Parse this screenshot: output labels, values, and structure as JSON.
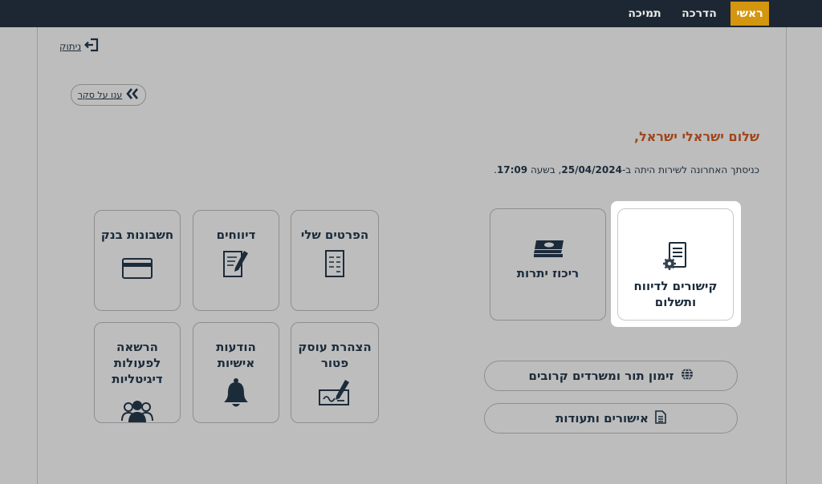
{
  "nav": {
    "home": "ראשי",
    "guide": "הדרכה",
    "support": "תמיכה"
  },
  "logout_label": "ניתוק",
  "survey_label": "ענו על סקר",
  "greeting": "שלום ישראלי ישראל,",
  "last_login": {
    "prefix": "כניסתך האחרונה לשירות היתה ב-",
    "date": "25/04/2024",
    "middle": ", בשעה ",
    "time": "17:09",
    "suffix": "."
  },
  "tiles": {
    "payment_links": "קישורים לדיווח\nותשלום",
    "balance_summary": "ריכוז יתרות",
    "my_details": "הפרטים שלי",
    "reports": "דיווחים",
    "bank_accounts": "חשבונות בנק",
    "exempt_declaration": "הצהרת עוסק\nפטור",
    "personal_messages": "הודעות\nאישיות",
    "digital_authorization": "הרשאה\nלפעולות\nדיגיטליות"
  },
  "links": {
    "appointments": "זימון תור ומשרדים קרובים",
    "certificates": "אישורים ותעודות"
  },
  "accent_colors": {
    "topbar": "#1c2733",
    "active_tab": "#d4950f",
    "greeting": "#a1461a"
  }
}
